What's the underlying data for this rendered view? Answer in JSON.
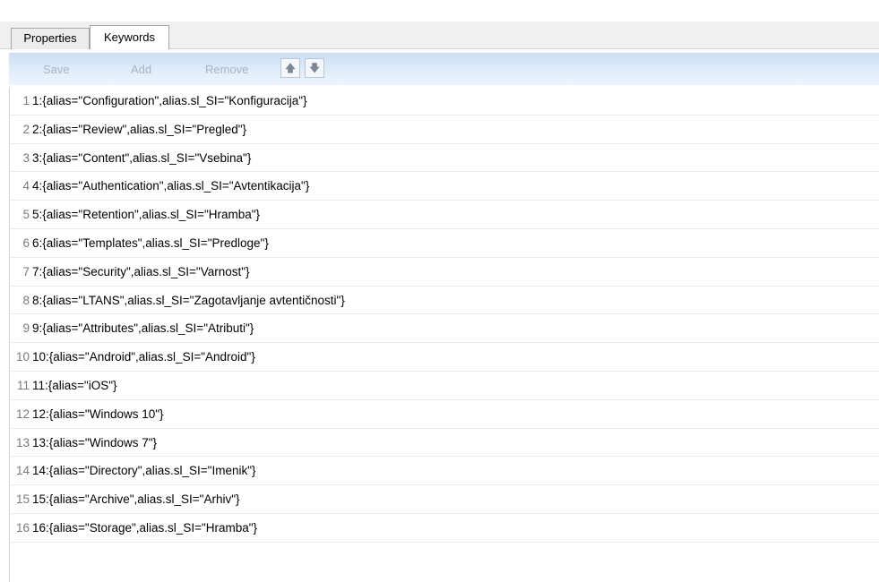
{
  "tabs": [
    {
      "label": "Properties",
      "active": false
    },
    {
      "label": "Keywords",
      "active": true
    }
  ],
  "toolbar": {
    "save_label": "Save",
    "add_label": "Add",
    "remove_label": "Remove",
    "move_up_icon": "arrow-up-icon",
    "move_down_icon": "arrow-down-icon",
    "up_glyph": "🡅",
    "down_glyph": "🡇"
  },
  "keywords": [
    {
      "index": "1",
      "value": "1:{alias=\"Configuration\",alias.sl_SI=\"Konfiguracija\"}"
    },
    {
      "index": "2",
      "value": "2:{alias=\"Review\",alias.sl_SI=\"Pregled\"}"
    },
    {
      "index": "3",
      "value": "3:{alias=\"Content\",alias.sl_SI=\"Vsebina\"}"
    },
    {
      "index": "4",
      "value": "4:{alias=\"Authentication\",alias.sl_SI=\"Avtentikacija\"}"
    },
    {
      "index": "5",
      "value": "5:{alias=\"Retention\",alias.sl_SI=\"Hramba\"}"
    },
    {
      "index": "6",
      "value": "6:{alias=\"Templates\",alias.sl_SI=\"Predloge\"}"
    },
    {
      "index": "7",
      "value": "7:{alias=\"Security\",alias.sl_SI=\"Varnost\"}"
    },
    {
      "index": "8",
      "value": "8:{alias=\"LTANS\",alias.sl_SI=\"Zagotavljanje avtentičnosti\"}"
    },
    {
      "index": "9",
      "value": "9:{alias=\"Attributes\",alias.sl_SI=\"Atributi\"}"
    },
    {
      "index": "10",
      "value": "10:{alias=\"Android\",alias.sl_SI=\"Android\"}"
    },
    {
      "index": "11",
      "value": "11:{alias=\"iOS\"}"
    },
    {
      "index": "12",
      "value": "12:{alias=\"Windows 10\"}"
    },
    {
      "index": "13",
      "value": "13:{alias=\"Windows 7\"}"
    },
    {
      "index": "14",
      "value": "14:{alias=\"Directory\",alias.sl_SI=\"Imenik\"}"
    },
    {
      "index": "15",
      "value": "15:{alias=\"Archive\",alias.sl_SI=\"Arhiv\"}"
    },
    {
      "index": "16",
      "value": "16:{alias=\"Storage\",alias.sl_SI=\"Hramba\"}"
    }
  ]
}
